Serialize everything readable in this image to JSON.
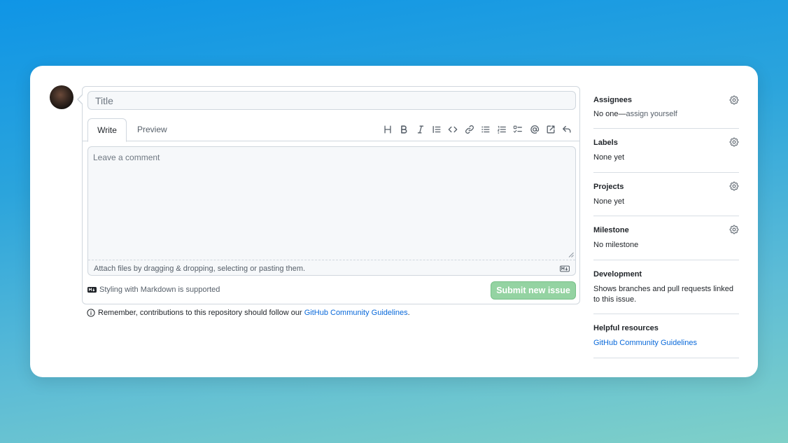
{
  "form": {
    "title_placeholder": "Title",
    "tabs": {
      "write": "Write",
      "preview": "Preview"
    },
    "toolbar_icons": [
      "heading-icon",
      "bold-icon",
      "italic-icon",
      "quote-icon",
      "code-icon",
      "link-icon",
      "bulleted-list-icon",
      "numbered-list-icon",
      "task-list-icon",
      "mention-icon",
      "reference-icon",
      "reply-icon"
    ],
    "comment_placeholder": "Leave a comment",
    "attach_text": "Attach files by dragging & dropping, selecting or pasting them.",
    "markdown_note": "Styling with Markdown is supported",
    "submit_label": "Submit new issue",
    "submit_color": "#94d3a2",
    "guidelines_prefix": "Remember, contributions to this repository should follow our ",
    "guidelines_link": "GitHub Community Guidelines",
    "guidelines_suffix": "."
  },
  "sidebar": {
    "assignees": {
      "title": "Assignees",
      "value_strong": "No one",
      "value_sep": "—",
      "value_link": "assign yourself"
    },
    "labels": {
      "title": "Labels",
      "value": "None yet"
    },
    "projects": {
      "title": "Projects",
      "value": "None yet"
    },
    "milestone": {
      "title": "Milestone",
      "value": "No milestone"
    },
    "development": {
      "title": "Development",
      "value": "Shows branches and pull requests linked to this issue."
    },
    "helpful": {
      "title": "Helpful resources",
      "link": "GitHub Community Guidelines"
    }
  },
  "colors": {
    "link": "#0969da",
    "border": "#d0d7de",
    "muted": "#57606a"
  }
}
